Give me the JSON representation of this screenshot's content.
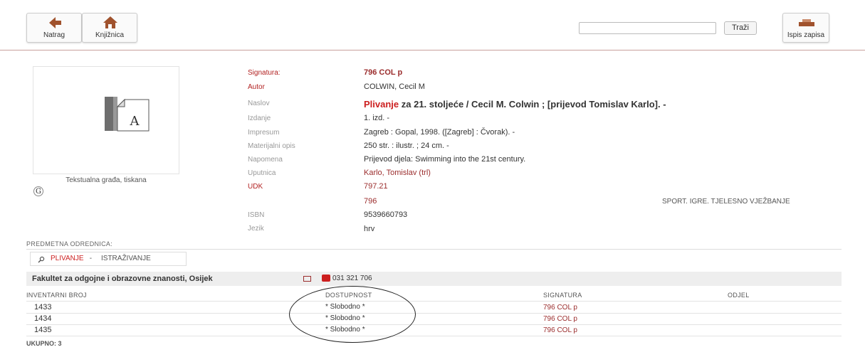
{
  "toolbar": {
    "back_label": "Natrag",
    "library_label": "Knjižnica",
    "search_value": "",
    "search_button": "Traži",
    "print_label": "Ispis zapisa"
  },
  "cover": {
    "letter": "A",
    "caption": "Tekstualna građa, tiskana",
    "badge": "G"
  },
  "record": {
    "signatura_label": "Signatura:",
    "signatura": "796 COL p",
    "autor_label": "Autor",
    "autor": "COLWIN, Cecil M",
    "naslov_label": "Naslov",
    "naslov_hl": "Plivanje",
    "naslov_rest": " za 21. stoljeće / Cecil M. Colwin ; [prijevod Tomislav Karlo]. -",
    "izdanje_label": "Izdanje",
    "izdanje": "1. izd. -",
    "impresum_label": "Impresum",
    "impresum": "Zagreb : Gopal, 1998. ([Zagreb] : Čvorak). -",
    "opis_label": "Materijalni opis",
    "opis": "250 str. : ilustr. ; 24 cm. -",
    "napomena_label": "Napomena",
    "napomena": "Prijevod djela: Swimming into the 21st century.",
    "uputnica_label": "Uputnica",
    "uputnica": "Karlo, Tomislav (trl)",
    "udk_label": "UDK",
    "udk1": "797.21",
    "udk2": "796",
    "udk2_desc": "SPORT. IGRE. TJELESNO VJEŽBANJE",
    "isbn_label": "ISBN",
    "isbn": "9539660793",
    "jezik_label": "Jezik",
    "jezik": "hrv"
  },
  "subject": {
    "section_label": "PREDMETNA ODREDNICA:",
    "term": "PLIVANJE",
    "sep": " - ",
    "sub": "ISTRAŽIVANJE"
  },
  "holdings": {
    "library": "Fakultet za odgojne i obrazovne znanosti, Osijek",
    "phone": "031 321 706",
    "headers": [
      "INVENTARNI BROJ",
      "DOSTUPNOST",
      "SIGNATURA",
      "ODJEL"
    ],
    "rows": [
      {
        "inv": "1433",
        "status": "* Slobodno *",
        "sig": "796 COL p",
        "odjel": ""
      },
      {
        "inv": "1434",
        "status": "* Slobodno *",
        "sig": "796 COL p",
        "odjel": ""
      },
      {
        "inv": "1435",
        "status": "* Slobodno *",
        "sig": "796 COL p",
        "odjel": ""
      }
    ],
    "total": "UKUPNO: 3"
  },
  "colors": {
    "accent": "#9b2d2d",
    "highlight": "#cc1f1f",
    "toolbar_border": "#c9a09c"
  },
  "icons": {
    "back": "arrow-left-icon",
    "library": "house-icon",
    "print": "printer-icon",
    "mail": "mail-icon",
    "phone": "phone-icon",
    "search": "search-magnifier-icon"
  }
}
